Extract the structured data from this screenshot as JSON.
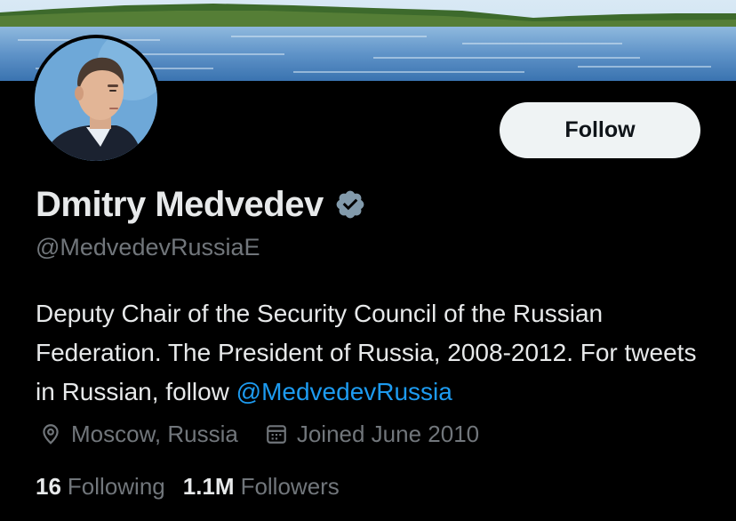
{
  "profile": {
    "display_name": "Dmitry Medvedev",
    "handle": "@MedvedevRussiaE",
    "verified_icon": "verified-badge-icon",
    "bio_text": "Deputy Chair of the Security Council of the Russian Federation. The President of Russia, 2008-2012. For tweets in Russian, follow ",
    "bio_link": "@MedvedevRussia",
    "location": "Moscow, Russia",
    "joined": "Joined June 2010",
    "following_count": "16",
    "following_label": "Following",
    "followers_count": "1.1M",
    "followers_label": "Followers"
  },
  "actions": {
    "follow_label": "Follow"
  },
  "icons": {
    "location": "map-pin-icon",
    "joined": "calendar-icon",
    "verified": "verified-badge-icon"
  },
  "colors": {
    "background": "#000000",
    "primary_text": "#e7e9ea",
    "secondary_text": "#71767b",
    "link": "#1d9bf0",
    "follow_button_bg": "#eff3f4",
    "follow_button_text": "#0f1419",
    "verified_badge": "#829aab"
  }
}
